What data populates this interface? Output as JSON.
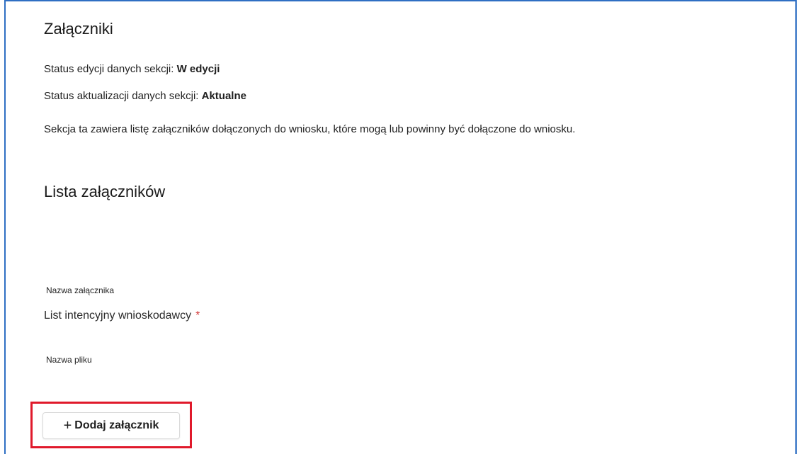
{
  "section": {
    "title": "Załączniki",
    "edit_status_label": "Status edycji danych sekcji:",
    "edit_status_value": "W edycji",
    "update_status_label": "Status aktualizacji danych sekcji:",
    "update_status_value": "Aktualne",
    "description": "Sekcja ta zawiera listę załączników dołączonych do wniosku, które mogą lub powinny być dołączone do wniosku."
  },
  "attachments": {
    "title": "Lista załączników",
    "name_label": "Nazwa załącznika",
    "name_value": "List intencyjny wnioskodawcy",
    "required_mark": "*",
    "file_label": "Nazwa pliku",
    "add_button_icon": "plus-icon",
    "add_button_label": "Dodaj załącznik"
  },
  "colors": {
    "frame_border": "#2f6fc3",
    "highlight": "#e0192b",
    "required": "#d23a3a"
  }
}
